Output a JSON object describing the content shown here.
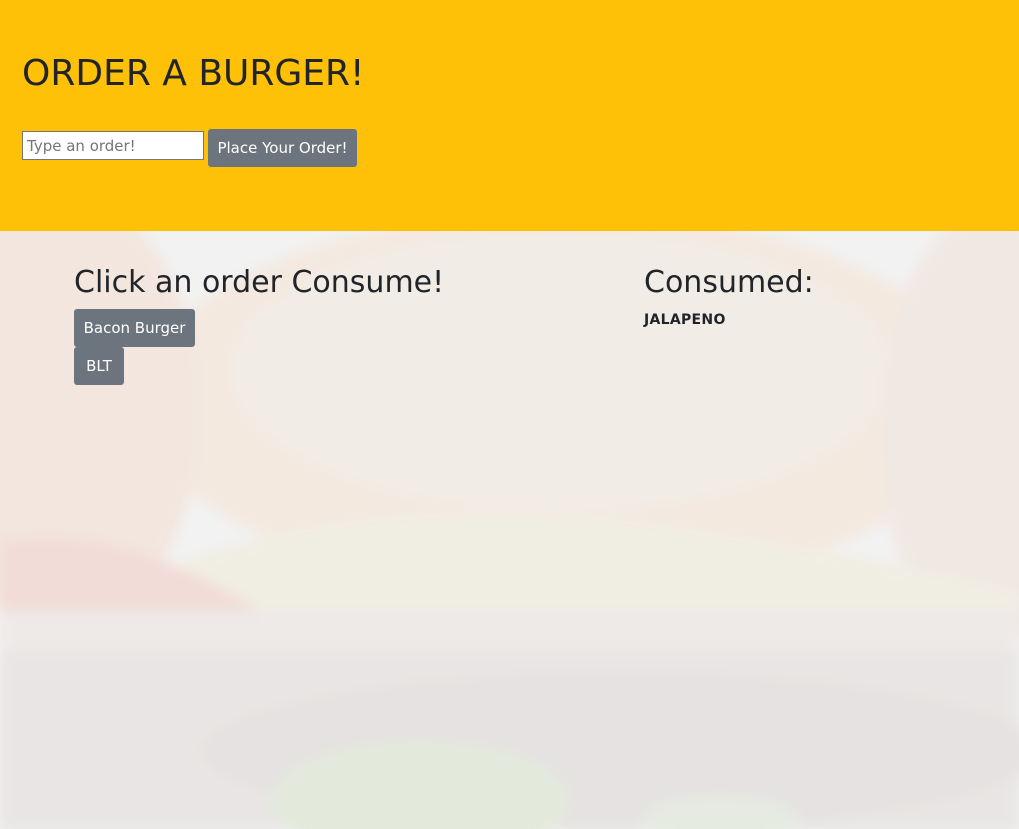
{
  "header": {
    "title": "ORDER A BURGER!",
    "input_placeholder": "Type an order!",
    "input_value": "",
    "submit_label": "Place Your Order!"
  },
  "orders": {
    "title": "Click an order Consume!",
    "items": [
      {
        "label": "Bacon Burger"
      },
      {
        "label": "BLT"
      }
    ]
  },
  "consumed": {
    "title": "Consumed:",
    "items": [
      {
        "label": "JALAPENO"
      }
    ]
  },
  "colors": {
    "header_bg": "#ffc107",
    "button_bg": "#6c757d",
    "text": "#212529"
  },
  "icons": {
    "background": "burger-photo"
  }
}
